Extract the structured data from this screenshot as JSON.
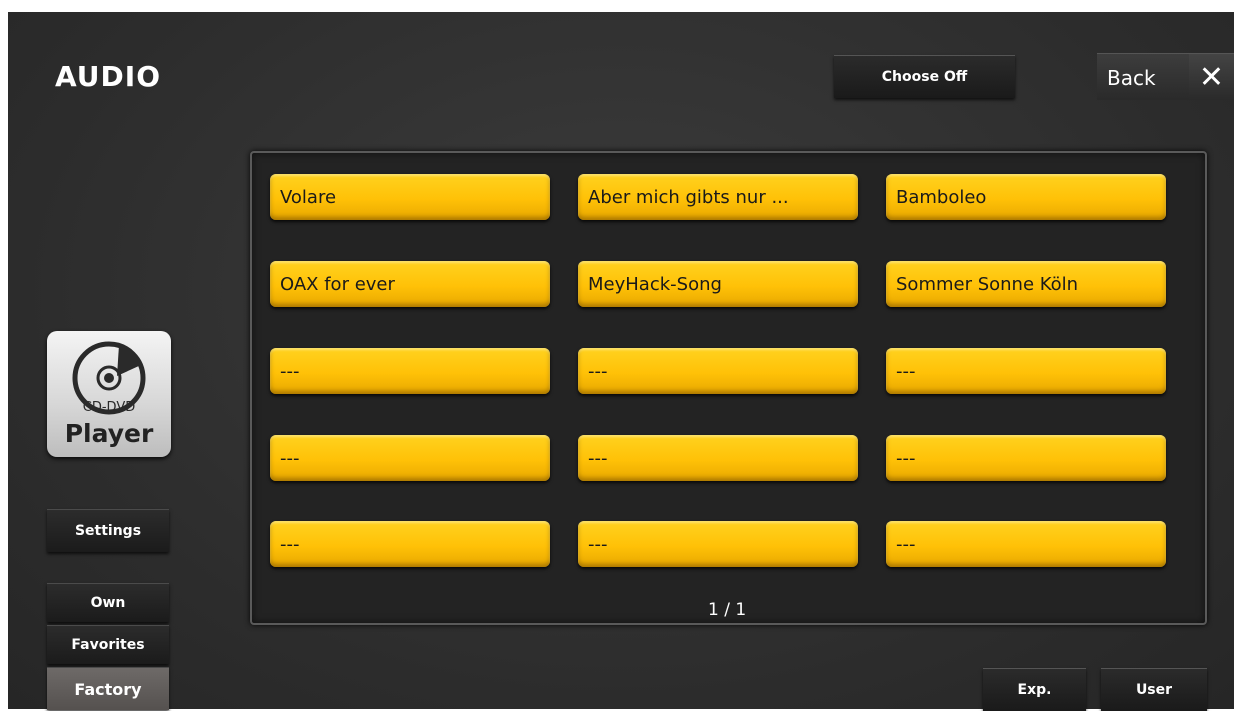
{
  "header": {
    "title": "AUDIO",
    "choose_off_label": "Choose Off",
    "back_label": "Back",
    "close_glyph": "✕"
  },
  "sidebar": {
    "player_icon_sublabel": "CD-DVD",
    "player_icon_label": "Player",
    "settings_label": "Settings",
    "own_label": "Own",
    "favorites_label": "Favorites",
    "factory_label": "Factory"
  },
  "songs": [
    "Volare",
    "Aber mich gibts nur ...",
    "Bamboleo",
    "OAX for ever",
    "MeyHack-Song",
    "Sommer Sonne Köln",
    "---",
    "---",
    "---",
    "---",
    "---",
    "---",
    "---",
    "---",
    "---"
  ],
  "pager": {
    "text": "1 / 1"
  },
  "footer": {
    "exp_label": "Exp.",
    "user_label": "User"
  },
  "colors": {
    "accent": "#ffc107",
    "background": "#2f2f2f"
  }
}
